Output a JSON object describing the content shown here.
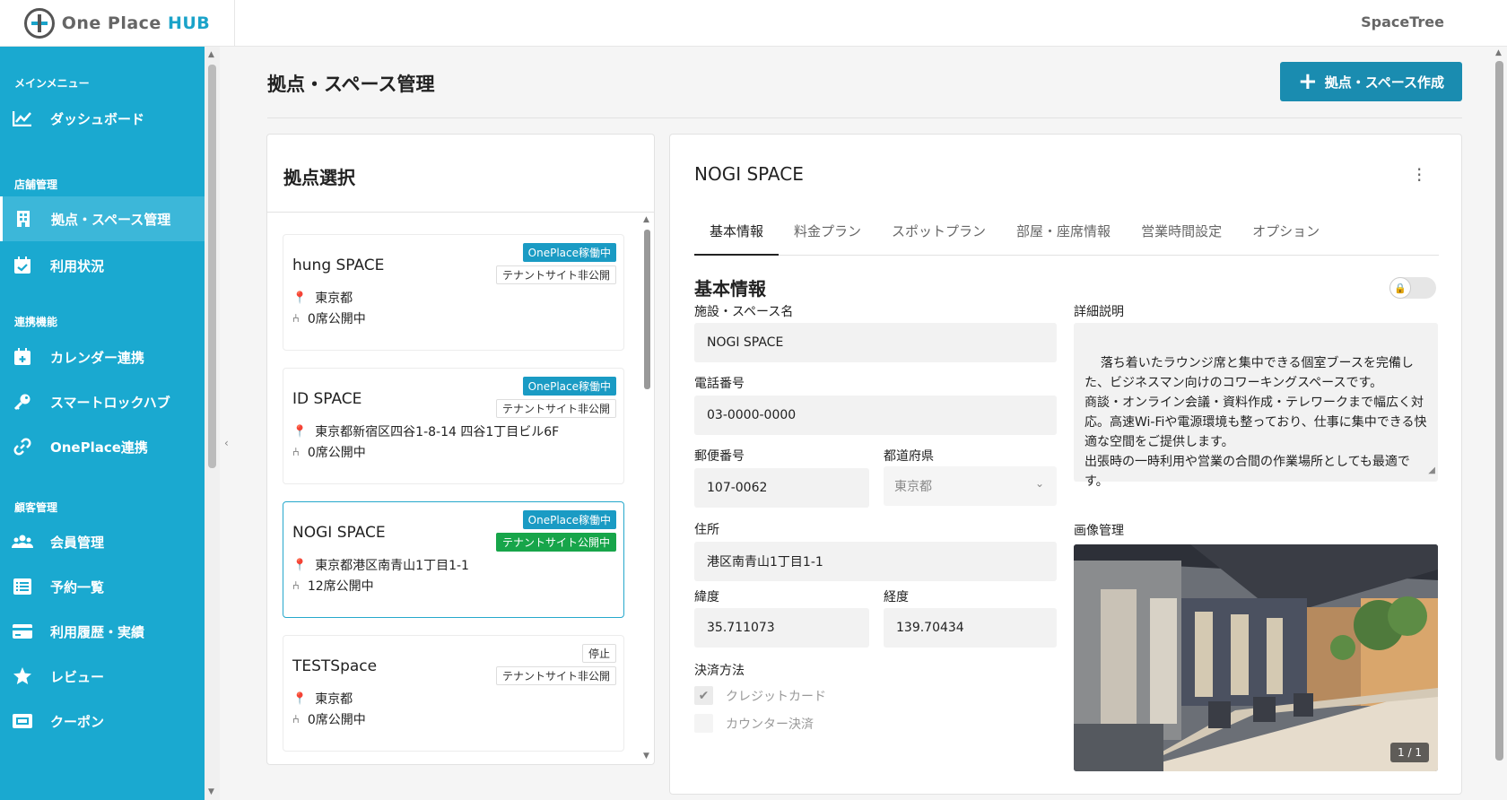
{
  "app": {
    "logo_text": "One Place ",
    "logo_hub": "HUB",
    "org_name": "SpaceTree"
  },
  "sidebar": {
    "sections": [
      {
        "label": "メインメニュー"
      },
      {
        "label": "店舗管理"
      },
      {
        "label": "連携機能"
      },
      {
        "label": "顧客管理"
      }
    ],
    "items": [
      {
        "label": "ダッシュボード",
        "icon": "chart-line-icon"
      },
      {
        "label": "拠点・スペース管理",
        "icon": "building-icon"
      },
      {
        "label": "利用状況",
        "icon": "calendar-check-icon"
      },
      {
        "label": "カレンダー連携",
        "icon": "calendar-plus-icon"
      },
      {
        "label": "スマートロックハブ",
        "icon": "key-icon"
      },
      {
        "label": "OnePlace連携",
        "icon": "link-icon"
      },
      {
        "label": "会員管理",
        "icon": "users-icon"
      },
      {
        "label": "予約一覧",
        "icon": "list-icon"
      },
      {
        "label": "利用履歴・実績",
        "icon": "credit-card-icon"
      },
      {
        "label": "レビュー",
        "icon": "star-icon"
      },
      {
        "label": "クーポン",
        "icon": "ticket-icon"
      }
    ]
  },
  "page": {
    "title": "拠点・スペース管理",
    "create_button": "拠点・スペース作成"
  },
  "base_panel": {
    "title": "拠点選択",
    "spaces": [
      {
        "name": "hung SPACE",
        "status": "OnePlace稼働中",
        "tenant": "テナントサイト非公開",
        "location": "東京都",
        "seats": "0席公開中"
      },
      {
        "name": "ID SPACE",
        "status": "OnePlace稼働中",
        "tenant": "テナントサイト非公開",
        "location": "東京都新宿区四谷1-8-14 四谷1丁目ビル6F",
        "seats": "0席公開中"
      },
      {
        "name": "NOGI SPACE",
        "status": "OnePlace稼働中",
        "tenant": "テナントサイト公開中",
        "location": "東京都港区南青山1丁目1-1",
        "seats": "12席公開中"
      },
      {
        "name": "TESTSpace",
        "status": "停止",
        "tenant": "テナントサイト非公開",
        "location": "東京都",
        "seats": "0席公開中"
      }
    ]
  },
  "detail": {
    "title": "NOGI SPACE",
    "tabs": [
      "基本情報",
      "料金プラン",
      "スポットプラン",
      "部屋・座席情報",
      "営業時間設定",
      "オプション"
    ],
    "section_title": "基本情報",
    "fields": {
      "name_label": "施設・スペース名",
      "name_value": "NOGI SPACE",
      "phone_label": "電話番号",
      "phone_value": "03-0000-0000",
      "postal_label": "郵便番号",
      "postal_value": "107-0062",
      "pref_label": "都道府県",
      "pref_value": "東京都",
      "address_label": "住所",
      "address_value": "港区南青山1丁目1-1",
      "lat_label": "緯度",
      "lat_value": "35.711073",
      "lng_label": "経度",
      "lng_value": "139.70434",
      "payment_label": "決済方法",
      "payment_credit": "クレジットカード",
      "payment_counter": "カウンター決済",
      "desc_label": "詳細説明",
      "desc_value": "落ち着いたラウンジ席と集中できる個室ブースを完備した、ビジネスマン向けのコワーキングスペースです。\n商談・オンライン会議・資料作成・テレワークまで幅広く対応。高速Wi-Fiや電源環境も整っており、仕事に集中できる快適な空間をご提供します。\n出張時の一時利用や営業の合間の作業場所としても最適です。",
      "image_label": "画像管理",
      "image_counter": "1 / 1"
    },
    "payment": {
      "credit_checked": true,
      "counter_checked": false
    }
  }
}
